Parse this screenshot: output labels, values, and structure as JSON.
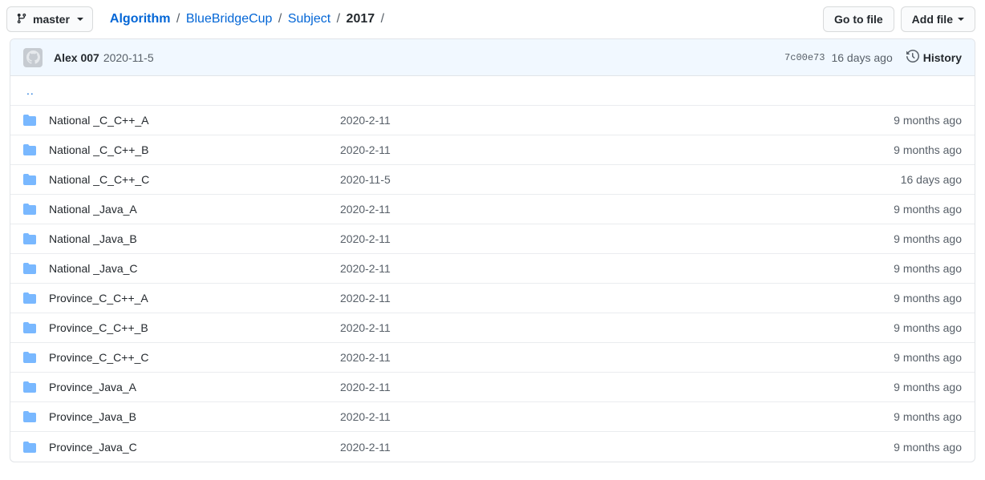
{
  "toolbar": {
    "branch": {
      "icon": "git-branch-icon",
      "label": "master",
      "caret": "caret-down-icon"
    },
    "breadcrumb": [
      {
        "text": "Algorithm",
        "type": "link",
        "bold": true
      },
      {
        "text": "BlueBridgeCup",
        "type": "link",
        "bold": false
      },
      {
        "text": "Subject",
        "type": "link",
        "bold": false
      },
      {
        "text": "2017",
        "type": "current",
        "bold": true
      }
    ],
    "separator": "/",
    "trailing_separator": "/",
    "go_to_file_label": "Go to file",
    "add_file_label": "Add file"
  },
  "commit": {
    "avatar_icon": "github-avatar-icon",
    "author": "Alex 007",
    "message": "2020-11-5",
    "sha": "7c00e73",
    "age": "16 days ago",
    "history_label": "History",
    "history_icon": "history-clock-icon"
  },
  "files": {
    "parent_dir_label": "..",
    "rows": [
      {
        "icon": "folder-icon",
        "name": "National _C_C++_A",
        "message": "2020-2-11",
        "age": "9 months ago"
      },
      {
        "icon": "folder-icon",
        "name": "National _C_C++_B",
        "message": "2020-2-11",
        "age": "9 months ago"
      },
      {
        "icon": "folder-icon",
        "name": "National _C_C++_C",
        "message": "2020-11-5",
        "age": "16 days ago"
      },
      {
        "icon": "folder-icon",
        "name": "National _Java_A",
        "message": "2020-2-11",
        "age": "9 months ago"
      },
      {
        "icon": "folder-icon",
        "name": "National _Java_B",
        "message": "2020-2-11",
        "age": "9 months ago"
      },
      {
        "icon": "folder-icon",
        "name": "National _Java_C",
        "message": "2020-2-11",
        "age": "9 months ago"
      },
      {
        "icon": "folder-icon",
        "name": "Province_C_C++_A",
        "message": "2020-2-11",
        "age": "9 months ago"
      },
      {
        "icon": "folder-icon",
        "name": "Province_C_C++_B",
        "message": "2020-2-11",
        "age": "9 months ago"
      },
      {
        "icon": "folder-icon",
        "name": "Province_C_C++_C",
        "message": "2020-2-11",
        "age": "9 months ago"
      },
      {
        "icon": "folder-icon",
        "name": "Province_Java_A",
        "message": "2020-2-11",
        "age": "9 months ago"
      },
      {
        "icon": "folder-icon",
        "name": "Province_Java_B",
        "message": "2020-2-11",
        "age": "9 months ago"
      },
      {
        "icon": "folder-icon",
        "name": "Province_Java_C",
        "message": "2020-2-11",
        "age": "9 months ago"
      }
    ]
  },
  "colors": {
    "link": "#0366d6",
    "text": "#24292e",
    "muted": "#586069",
    "folder": "#79b8ff",
    "commit_bar_bg": "#f1f8ff",
    "border": "#e1e4e8"
  }
}
